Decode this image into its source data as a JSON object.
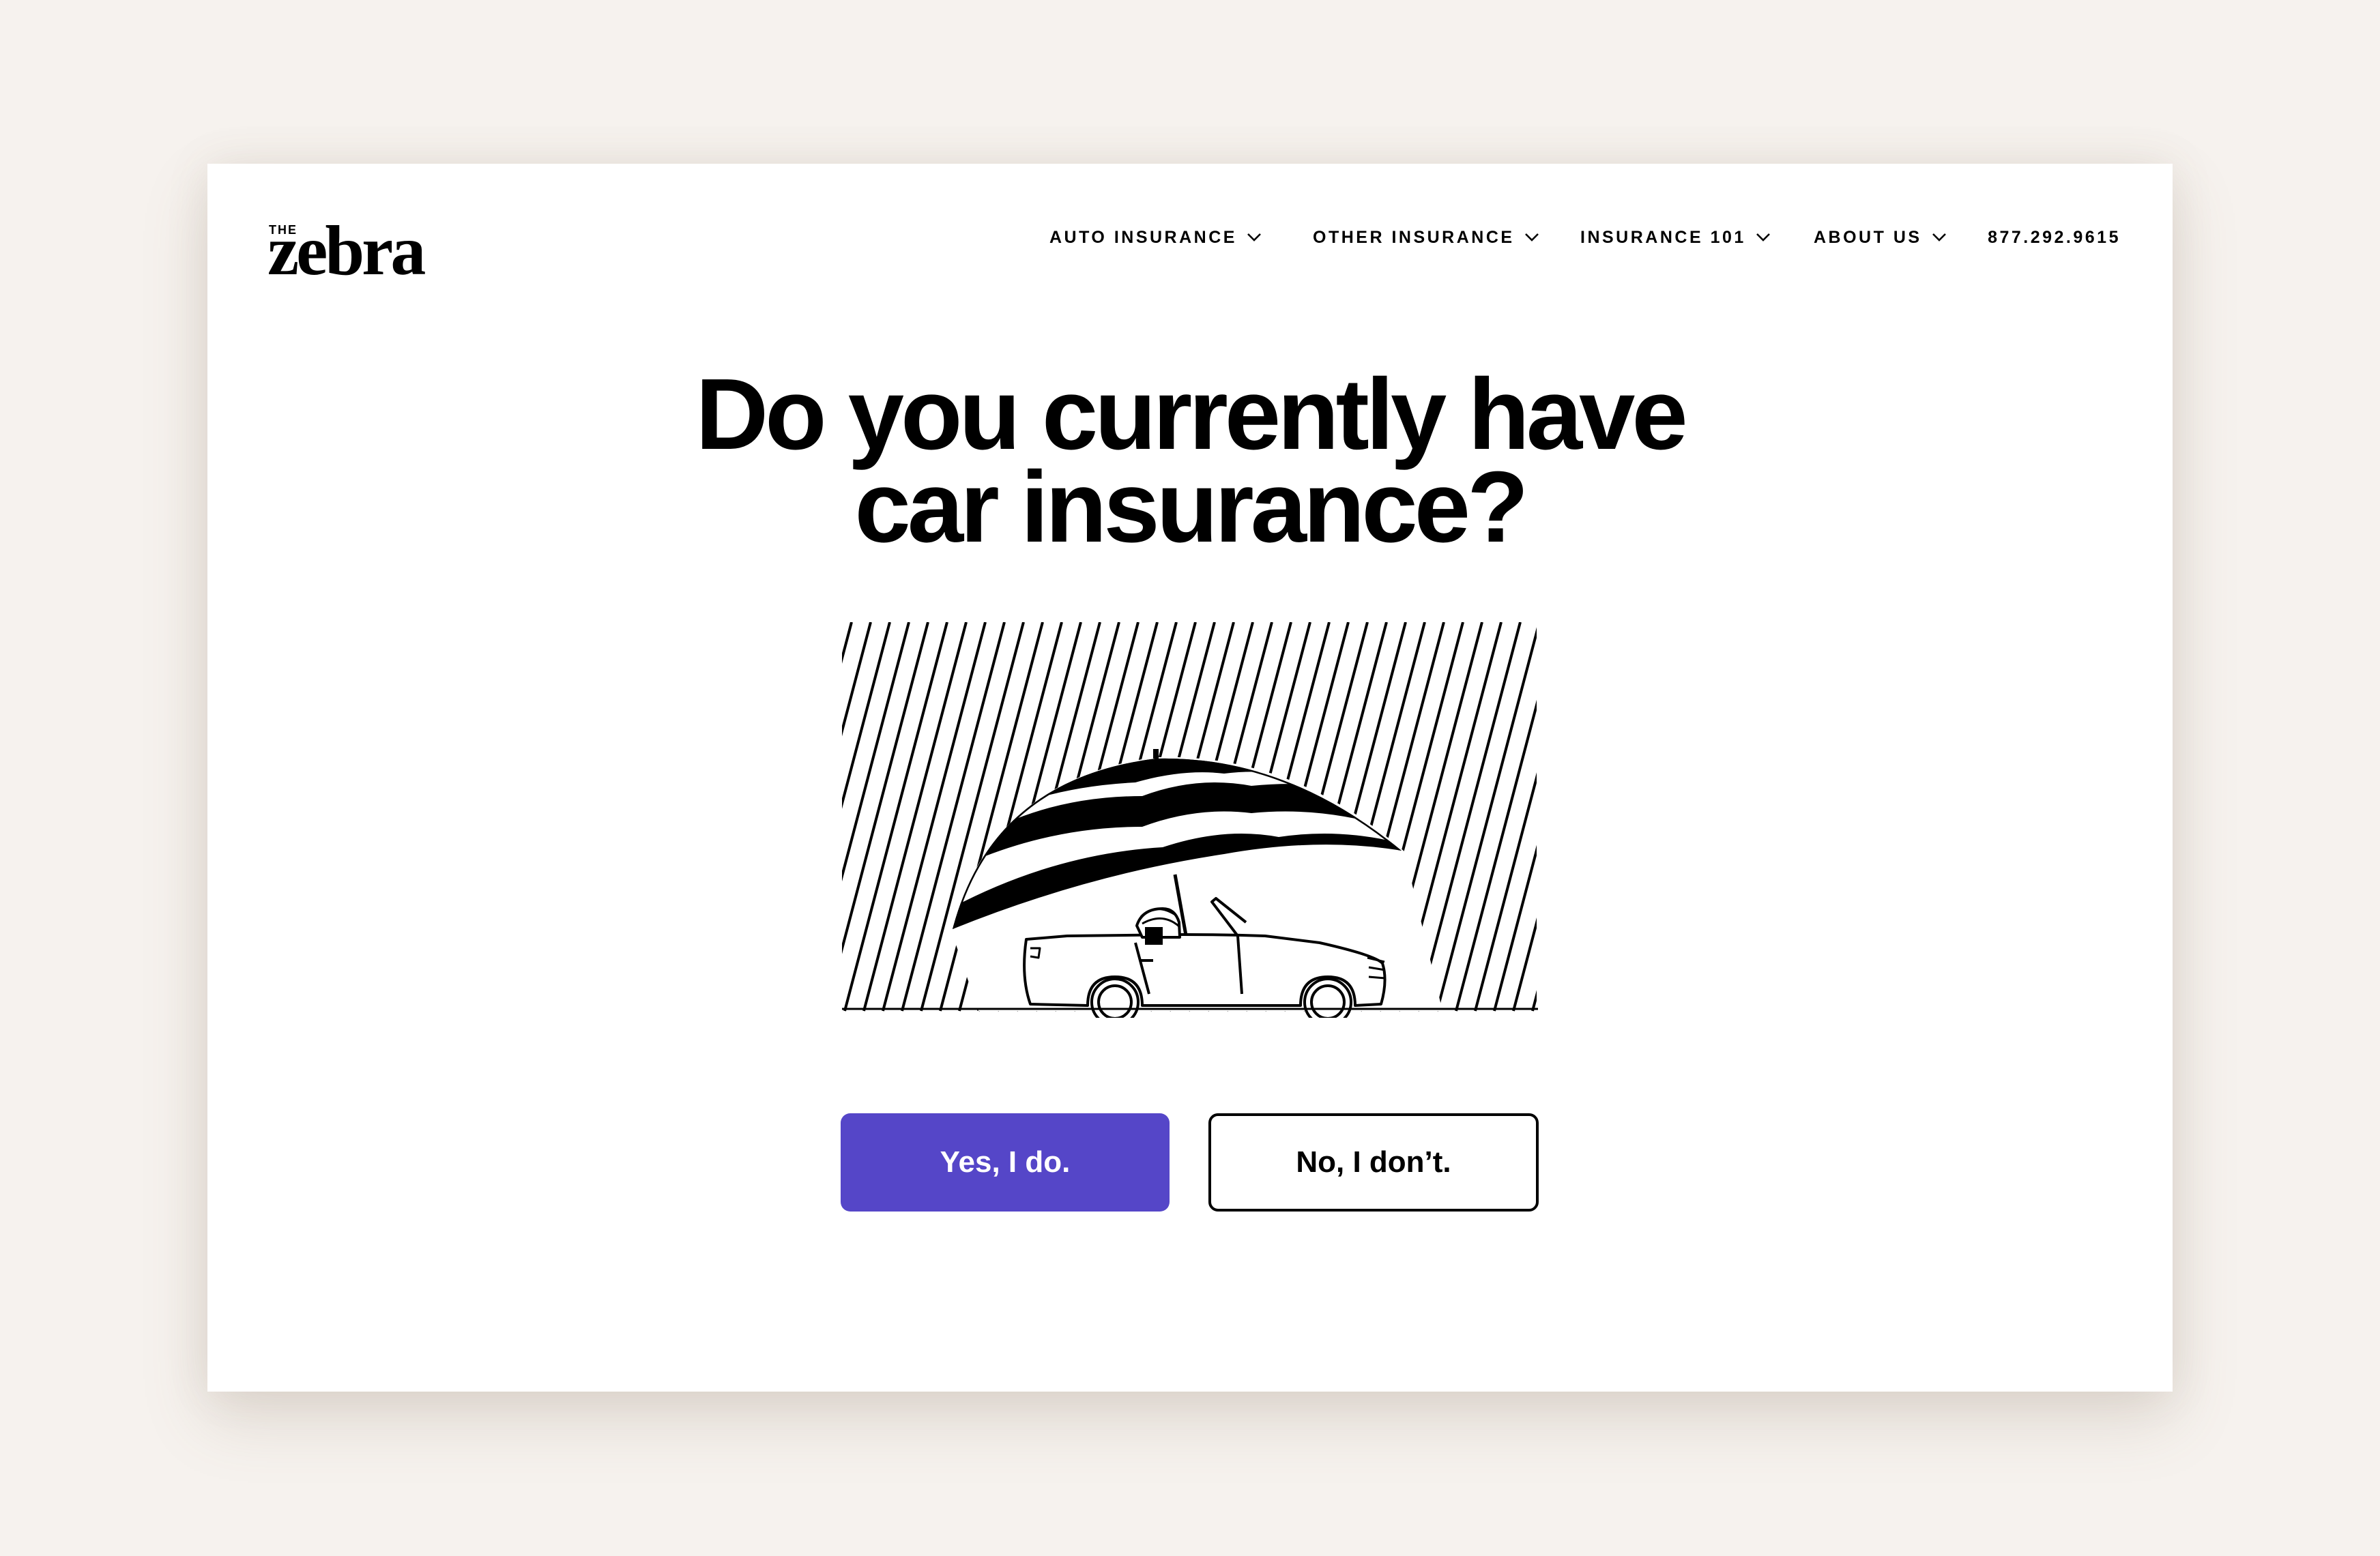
{
  "brand": {
    "the": "THE",
    "name": "zebra"
  },
  "nav": {
    "items": [
      {
        "label": "AUTO INSURANCE"
      },
      {
        "label": "OTHER INSURANCE"
      },
      {
        "label": "INSURANCE 101"
      },
      {
        "label": "ABOUT US"
      }
    ],
    "phone": "877.292.9615"
  },
  "headline": {
    "line1": "Do you currently have",
    "line2": "car insurance?"
  },
  "illustration": {
    "icon": "car-under-umbrella-in-rain-illustration"
  },
  "answers": {
    "yes_label": "Yes, I do.",
    "no_label": "No, I don’t."
  },
  "colors": {
    "background": "#f6f2ee",
    "primary": "#5546c8",
    "card": "#ffffff",
    "text": "#000000"
  }
}
